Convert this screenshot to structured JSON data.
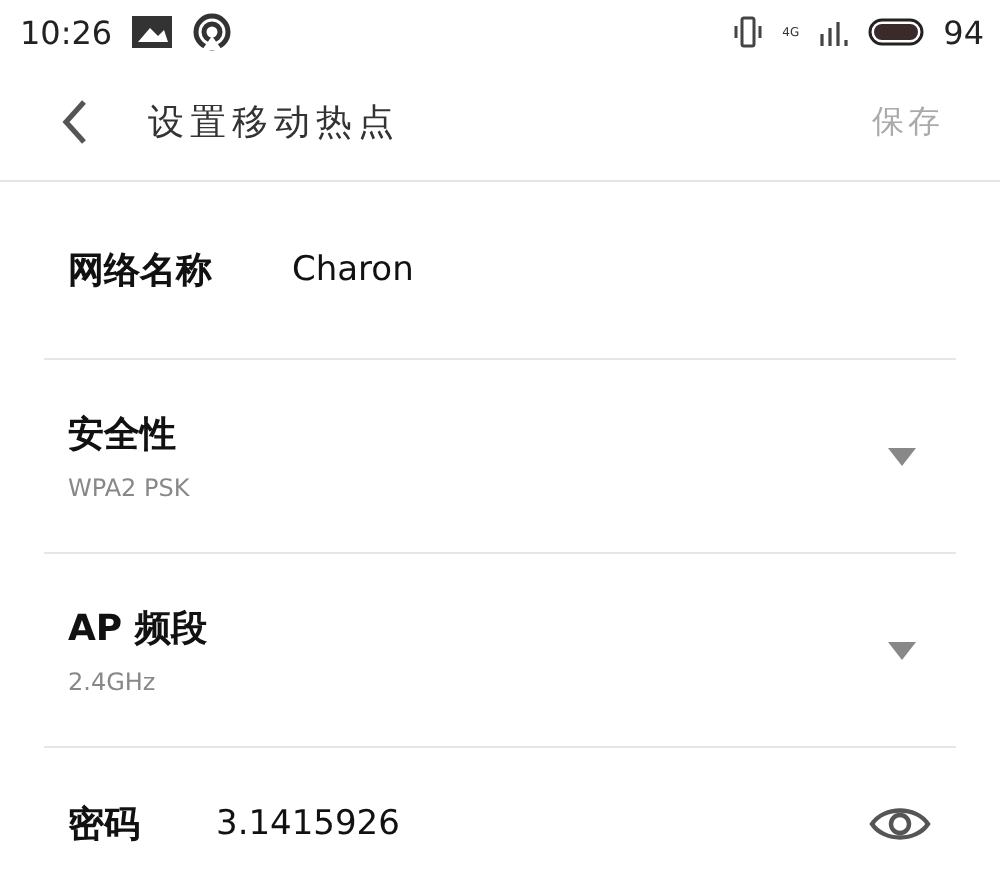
{
  "status_bar": {
    "time": "10:26",
    "network": "4G",
    "battery": "94"
  },
  "header": {
    "title": "设置移动热点",
    "save": "保存"
  },
  "rows": [
    {
      "kind": "text",
      "label": "网络名称",
      "value": "Charon"
    },
    {
      "kind": "select",
      "label": "安全性",
      "value": "WPA2 PSK"
    },
    {
      "kind": "select",
      "label": "AP 频段",
      "value": "2.4GHz"
    },
    {
      "kind": "password",
      "label": "密码",
      "value": "3.1415926"
    }
  ]
}
